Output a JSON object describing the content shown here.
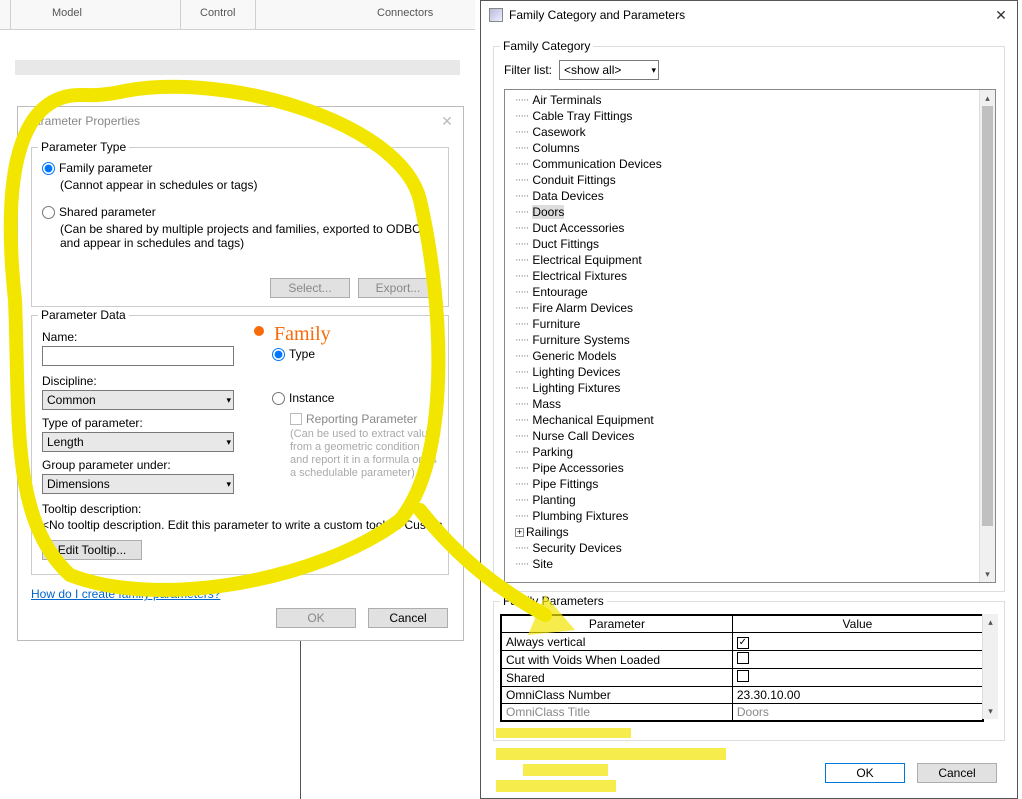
{
  "ribbon": {
    "model": "Model",
    "control": "Control",
    "connectors": "Connectors"
  },
  "dlg1": {
    "title": "Parameter Properties",
    "ptype_label": "Parameter Type",
    "family_param": "Family parameter",
    "family_note": "(Cannot appear in schedules or tags)",
    "shared_param": "Shared parameter",
    "shared_note": "(Can be shared by multiple projects and families, exported to ODBC, and appear in schedules and tags)",
    "select_btn": "Select...",
    "export_btn": "Export...",
    "pdata_label": "Parameter Data",
    "name_label": "Name:",
    "name_value": "",
    "discipline_label": "Discipline:",
    "discipline_value": "Common",
    "typeofparam_label": "Type of parameter:",
    "typeofparam_value": "Length",
    "group_label": "Group parameter under:",
    "group_value": "Dimensions",
    "tooltip_label": "Tooltip description:",
    "tooltip_text": "<No tooltip description. Edit this parameter to write a custom tooltip. Custom t...",
    "edit_tooltip_btn": "Edit Tooltip...",
    "type_radio": "Type",
    "instance_radio": "Instance",
    "reporting": "Reporting Parameter",
    "reporting_note": "(Can be used to extract value from a geometric condition and report it in a formula or as a schedulable parameter)",
    "help_link": "How do I create family parameters?",
    "ok": "OK",
    "cancel": "Cancel"
  },
  "annot": {
    "hand": "Family"
  },
  "dlg2": {
    "title": "Family Category and Parameters",
    "famcat_label": "Family Category",
    "filter_label": "Filter list:",
    "filter_value": "<show all>",
    "categories": [
      "Air Terminals",
      "Cable Tray Fittings",
      "Casework",
      "Columns",
      "Communication Devices",
      "Conduit Fittings",
      "Data Devices",
      "Doors",
      "Duct Accessories",
      "Duct Fittings",
      "Electrical Equipment",
      "Electrical Fixtures",
      "Entourage",
      "Fire Alarm Devices",
      "Furniture",
      "Furniture Systems",
      "Generic Models",
      "Lighting Devices",
      "Lighting Fixtures",
      "Mass",
      "Mechanical Equipment",
      "Nurse Call Devices",
      "Parking",
      "Pipe Accessories",
      "Pipe Fittings",
      "Planting",
      "Plumbing Fixtures",
      "Railings",
      "Security Devices",
      "Site"
    ],
    "cat_selected": "Doors",
    "cat_expandable": "Railings",
    "famparams_label": "Family Parameters",
    "th_param": "Parameter",
    "th_value": "Value",
    "rows": [
      {
        "p": "Always vertical",
        "v_check": true
      },
      {
        "p": "Cut with Voids When Loaded",
        "v_check": false
      },
      {
        "p": "Shared",
        "v_check": false
      },
      {
        "p": "OmniClass Number",
        "v": "23.30.10.00"
      },
      {
        "p": "OmniClass Title",
        "v": "Doors",
        "grey": true
      }
    ],
    "ok": "OK",
    "cancel": "Cancel"
  }
}
